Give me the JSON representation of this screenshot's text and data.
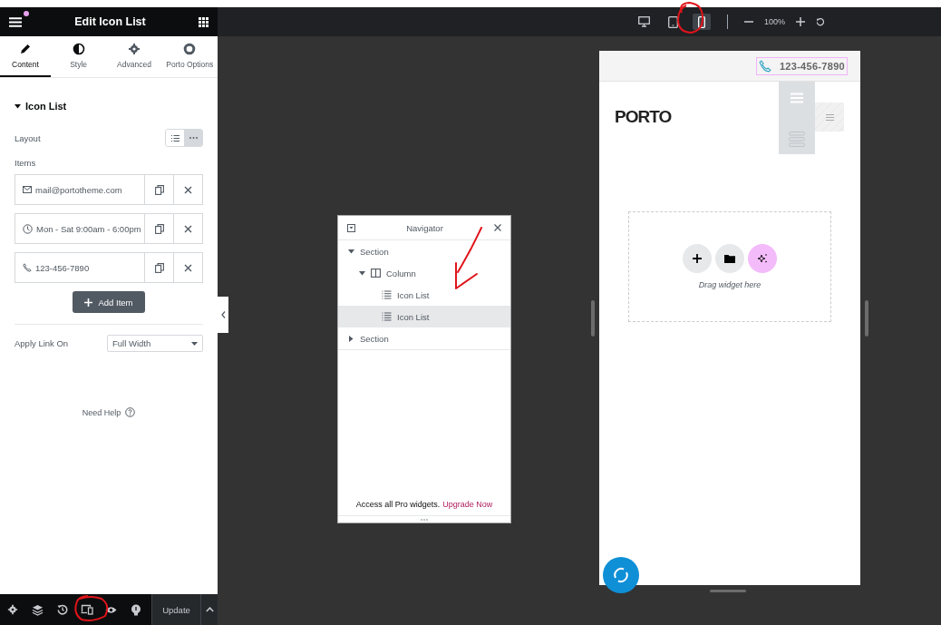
{
  "panel": {
    "title": "Edit Icon List",
    "notification": true,
    "tabs": [
      {
        "kind": "content",
        "label": "Content",
        "selected": true
      },
      {
        "kind": "style",
        "label": "Style",
        "selected": false
      },
      {
        "kind": "advanced",
        "label": "Advanced",
        "selected": false
      },
      {
        "kind": "porto",
        "label": "Porto Options",
        "selected": false
      }
    ],
    "section": {
      "title": "Icon List",
      "expanded": true
    },
    "layout": {
      "label": "Layout",
      "options": [
        {
          "kind": "list",
          "selected": false
        },
        {
          "kind": "inline",
          "selected": true
        }
      ]
    },
    "items_label": "Items",
    "items": [
      {
        "kind": "email",
        "text": "mail@portotheme.com"
      },
      {
        "kind": "clock",
        "text": "Mon - Sat 9:00am - 6:00pm"
      },
      {
        "kind": "phone",
        "text": "123-456-7890"
      }
    ],
    "add_button": "Add Item",
    "apply_link": {
      "label": "Apply Link On",
      "value": "Full Width"
    },
    "help": "Need Help"
  },
  "footer": {
    "tools": [
      {
        "kind": "settings"
      },
      {
        "kind": "layers"
      },
      {
        "kind": "history"
      },
      {
        "kind": "responsive"
      },
      {
        "kind": "preview"
      },
      {
        "kind": "hints"
      }
    ],
    "update": "Update"
  },
  "toolbar": {
    "devices": [
      {
        "kind": "desktop",
        "selected": false
      },
      {
        "kind": "tablet",
        "selected": false
      },
      {
        "kind": "mobile",
        "selected": true
      }
    ],
    "zoom": "100%"
  },
  "navigator": {
    "title": "Navigator",
    "tree": [
      {
        "label": "Section",
        "expanded": true,
        "selected": false,
        "children": [
          {
            "kind": "column",
            "label": "Column",
            "expanded": true,
            "selected": false,
            "children": [
              {
                "kind": "widget",
                "label": "Icon List",
                "selected": false
              },
              {
                "kind": "widget",
                "label": "Icon List",
                "selected": true
              }
            ]
          }
        ]
      },
      {
        "label": "Section",
        "expanded": false,
        "selected": false
      }
    ],
    "footer_text": "Access all Pro widgets.",
    "footer_link": "Upgrade Now"
  },
  "preview": {
    "phone": "123-456-7890",
    "logo": "PORTO",
    "drop_hint": "Drag widget here"
  }
}
